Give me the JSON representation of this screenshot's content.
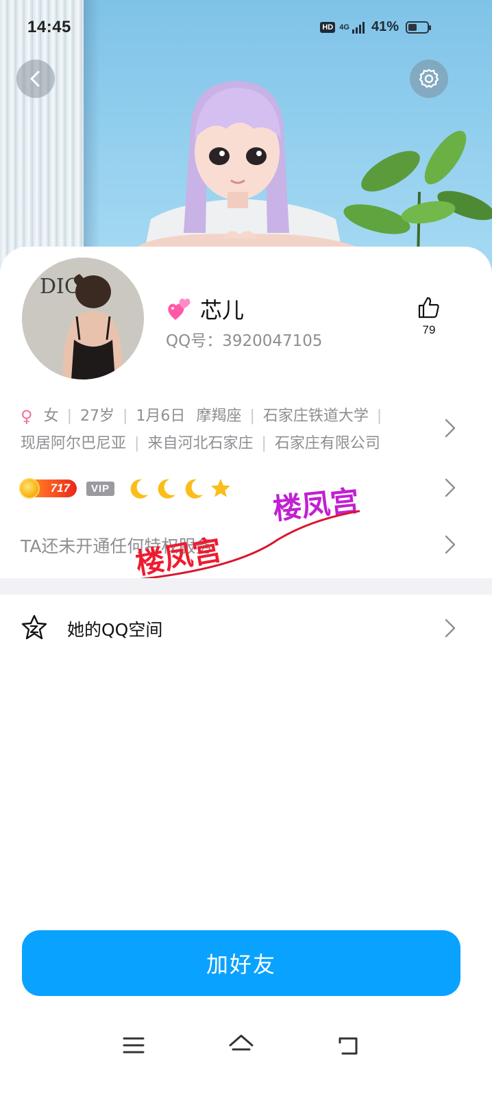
{
  "status_bar": {
    "time": "14:45",
    "hd": "HD",
    "network": "4G",
    "battery_percent": "41%"
  },
  "header": {
    "back_icon": "chevron-left-icon",
    "settings_icon": "gear-icon"
  },
  "profile": {
    "nickname": "芯儿",
    "qq_number": "QQ号：3920047105",
    "like_count": "79",
    "avatar_text": "DIOR",
    "info_line1": [
      "♀",
      "女",
      "27岁",
      "1月6日",
      "摩羯座",
      "石家庄铁道大学"
    ],
    "info_line2": [
      "现居阿尔巴尼亚",
      "来自河北石家庄",
      "石家庄有限公司"
    ],
    "level_value": "717",
    "vip_label": "VIP",
    "level_icons": [
      "moon-icon",
      "moon-icon",
      "moon-icon",
      "star-icon"
    ],
    "privilege_text": "TA还未开通任何特权服务"
  },
  "watermark": {
    "text_a": "楼凤宫",
    "text_b": "楼凤宫"
  },
  "qzone": {
    "label": "她的QQ空间"
  },
  "actions": {
    "add_friend": "加好友"
  },
  "colors": {
    "accent": "#0aa2ff",
    "female": "#f36fa6",
    "muted_text": "#8e8e93"
  }
}
